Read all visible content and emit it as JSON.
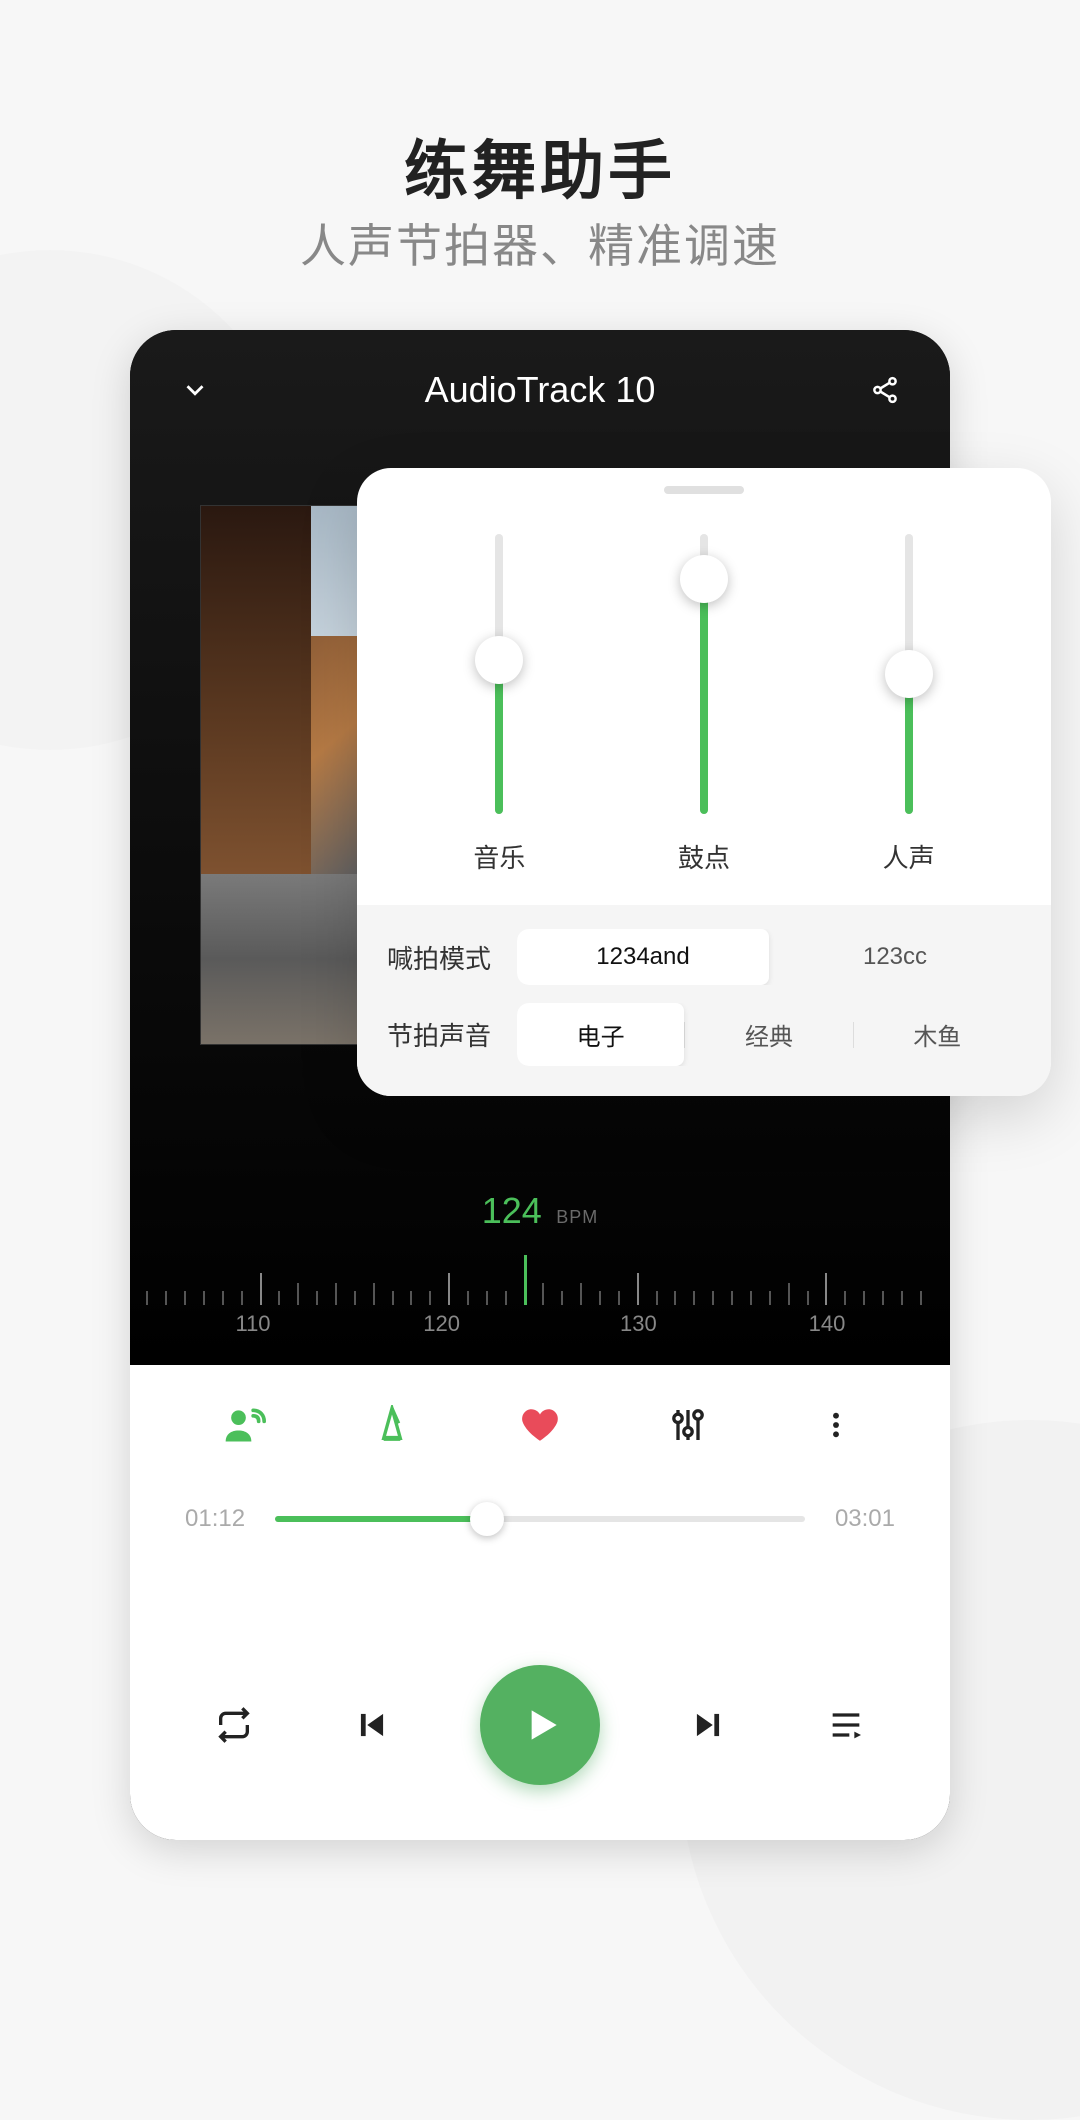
{
  "hero": {
    "title": "练舞助手",
    "subtitle": "人声节拍器、精准调速"
  },
  "player": {
    "title": "AudioTrack 10",
    "bpm_value": "124",
    "bpm_unit": "BPM",
    "ruler_labels": [
      "110",
      "120",
      "130",
      "140"
    ],
    "current_time": "01:12",
    "total_time": "03:01",
    "progress_pct": 40
  },
  "popup": {
    "sliders": [
      {
        "label": "音乐",
        "value_pct": 55
      },
      {
        "label": "鼓点",
        "value_pct": 84
      },
      {
        "label": "人声",
        "value_pct": 50
      }
    ],
    "mode_label": "喊拍模式",
    "mode_options": [
      "1234and",
      "123cc"
    ],
    "mode_selected": 0,
    "sound_label": "节拍声音",
    "sound_options": [
      "电子",
      "经典",
      "木鱼"
    ],
    "sound_selected": 0
  },
  "colors": {
    "accent": "#4bbf5a"
  }
}
